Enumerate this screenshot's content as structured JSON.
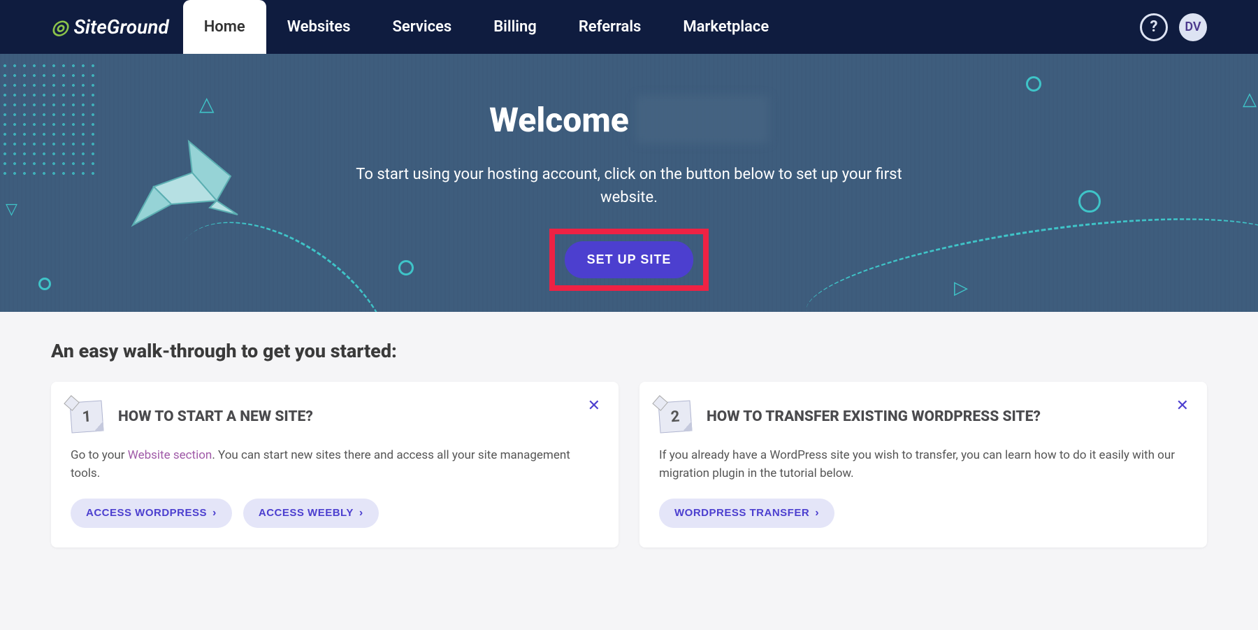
{
  "brand": "SiteGround",
  "nav": {
    "items": [
      "Home",
      "Websites",
      "Services",
      "Billing",
      "Referrals",
      "Marketplace"
    ],
    "active": 0
  },
  "help_glyph": "?",
  "avatar": "DV",
  "hero": {
    "welcome": "Welcome",
    "subtitle": "To start using your hosting account, click on the button below to set up your first website.",
    "cta": "SET UP SITE"
  },
  "walkthrough": {
    "title": "An easy walk-through to get you started:",
    "cards": [
      {
        "step": "1",
        "title": "HOW TO START A NEW SITE?",
        "body_prefix": "Go to your ",
        "body_link": "Website section",
        "body_suffix": ". You can start new sites there and access all your site management tools.",
        "actions": [
          "ACCESS WORDPRESS",
          "ACCESS WEEBLY"
        ]
      },
      {
        "step": "2",
        "title": "HOW TO TRANSFER EXISTING WORDPRESS SITE?",
        "body": "If you already have a WordPress site you wish to transfer, you can learn how to do it easily with our migration plugin in the tutorial below.",
        "actions": [
          "WORDPRESS TRANSFER"
        ]
      }
    ]
  }
}
